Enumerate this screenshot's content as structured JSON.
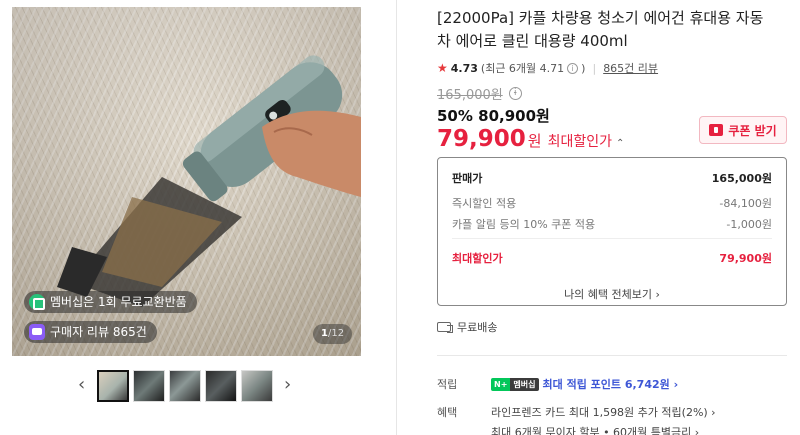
{
  "gallery": {
    "badges": [
      "멤버십은 1회 무료교환반품",
      "구매자 리뷰 865건"
    ],
    "counter": {
      "current": "1",
      "total": "/12"
    },
    "prev_arrow": "‹",
    "next_arrow": "›"
  },
  "product": {
    "title": "[22000Pa] 카플 차량용 청소기 에어건 휴대용 자동차 에어로 클린 대용량 400ml"
  },
  "rating": {
    "star": "★",
    "score": "4.73",
    "recent": "(최근 6개월 4.71",
    "recent_close": ")",
    "info": "i",
    "reviews": "865건 리뷰"
  },
  "price": {
    "original": "165,000원",
    "original_info": "i",
    "discount_rate": "50%",
    "sale": "80,900원",
    "best": "79,900",
    "best_unit": "원",
    "best_label": "최대할인가",
    "best_chevron": "⌃",
    "coupon_label": "쿠폰 받기"
  },
  "price_box": {
    "rows": [
      {
        "label": "판매가",
        "value": "165,000원"
      },
      {
        "label": "즉시할인 적용",
        "value": "-84,100원"
      },
      {
        "label": "카플 알림 등의 10% 쿠폰 적용",
        "value": "-1,000원"
      },
      {
        "label": "최대할인가",
        "value": "79,900원"
      }
    ],
    "benefit_link": "나의 혜택 전체보기 ›"
  },
  "shipping": {
    "label": "무료배송"
  },
  "benefits": {
    "point_key": "적립",
    "npay_n": "N+",
    "npay_m": "멤버십",
    "point_text": "최대 적립 포인트 6,742원 ›",
    "card_key": "혜택",
    "card_text": "라인프렌즈 카드 최대 1,598원 추가 적립(2%) ›",
    "installment_text": "최대 6개월 무이자 할부 • 60개월 특별금리 ›"
  },
  "colors": {
    "accent_red": "#e6213f",
    "point_blue": "#3e57d6",
    "npay_green": "#03c75a"
  }
}
